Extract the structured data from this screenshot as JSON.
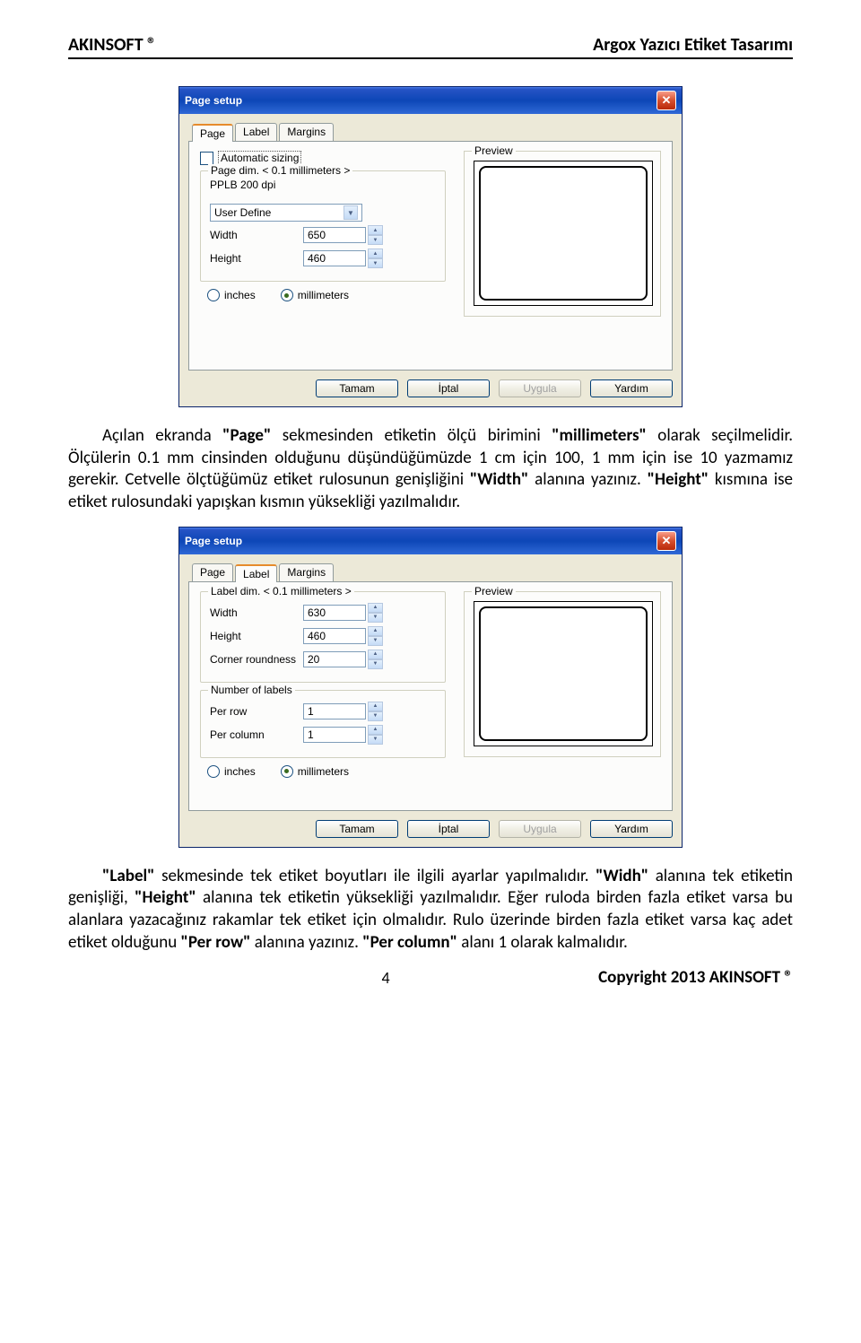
{
  "header": {
    "left": "AKINSOFT ®",
    "right": "Argox Yazıcı Etiket Tasarımı"
  },
  "dialog1": {
    "title": "Page setup",
    "tabs": [
      "Page",
      "Label",
      "Margins"
    ],
    "active_tab": 0,
    "auto_sizing": "Automatic sizing",
    "pagedim_group": "Page dim. < 0.1 millimeters >",
    "resolution": "PPLB 200 dpi",
    "select_value": "User Define",
    "width_label": "Width",
    "width_value": "650",
    "height_label": "Height",
    "height_value": "460",
    "radio_inches": "inches",
    "radio_mm": "millimeters",
    "preview_label": "Preview",
    "buttons": {
      "ok": "Tamam",
      "cancel": "İptal",
      "apply": "Uygula",
      "help": "Yardım"
    }
  },
  "para1": {
    "t1": "Açılan ekranda ",
    "b1": "\"Page\"",
    "t2": " sekmesinden etiketin ölçü birimini ",
    "b2": "\"millimeters\"",
    "t3": " olarak seçilmelidir. Ölçülerin 0.1 mm cinsinden olduğunu düşündüğümüzde 1 cm için 100, 1 mm için ise 10 yazmamız gerekir. Cetvelle ölçtüğümüz etiket rulosunun genişliğini ",
    "b3": "\"Width\"",
    "t4": " alanına yazınız. ",
    "b4": "\"Height\"",
    "t5": " kısmına ise etiket rulosundaki yapışkan kısmın yüksekliği yazılmalıdır."
  },
  "dialog2": {
    "title": "Page setup",
    "tabs": [
      "Page",
      "Label",
      "Margins"
    ],
    "active_tab": 1,
    "labeldim_group": "Label dim. < 0.1 millimeters >",
    "width_label": "Width",
    "width_value": "630",
    "height_label": "Height",
    "height_value": "460",
    "corner_label": "Corner roundness",
    "corner_value": "20",
    "numlabels_group": "Number of labels",
    "perrow_label": "Per row",
    "perrow_value": "1",
    "percol_label": "Per column",
    "percol_value": "1",
    "radio_inches": "inches",
    "radio_mm": "millimeters",
    "preview_label": "Preview",
    "buttons": {
      "ok": "Tamam",
      "cancel": "İptal",
      "apply": "Uygula",
      "help": "Yardım"
    }
  },
  "para2": {
    "b1": "\"Label\"",
    "t1": " sekmesinde tek etiket boyutları ile ilgili ayarlar yapılmalıdır. ",
    "b2": "\"Widh\"",
    "t2": " alanına tek etiketin genişliği, ",
    "b3": "\"Height\"",
    "t3": " alanına tek etiketin yüksekliği yazılmalıdır. Eğer ruloda birden fazla etiket varsa bu alanlara yazacağınız rakamlar tek etiket için olmalıdır. Rulo üzerinde birden fazla etiket varsa kaç adet etiket olduğunu ",
    "b4": "\"Per row\"",
    "t4": " alanına yazınız. ",
    "b5": "\"Per column\"",
    "t5": " alanı 1 olarak kalmalıdır."
  },
  "footer": {
    "copyright": "Copyright 2013 AKINSOFT ®",
    "page": "4"
  }
}
